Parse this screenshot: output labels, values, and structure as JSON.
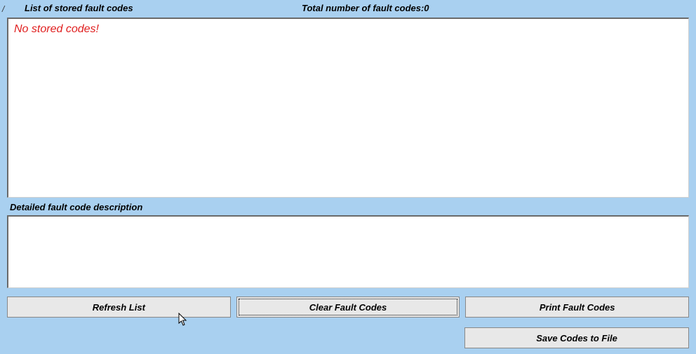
{
  "header": {
    "list_label": "List of stored fault codes",
    "total_label": "Total number of fault codes:0"
  },
  "list_panel": {
    "empty_message": "No stored codes!"
  },
  "detail": {
    "label": "Detailed fault code description"
  },
  "buttons": {
    "refresh": "Refresh List",
    "clear": "Clear Fault Codes",
    "print": "Print Fault Codes",
    "save": "Save Codes to File"
  }
}
